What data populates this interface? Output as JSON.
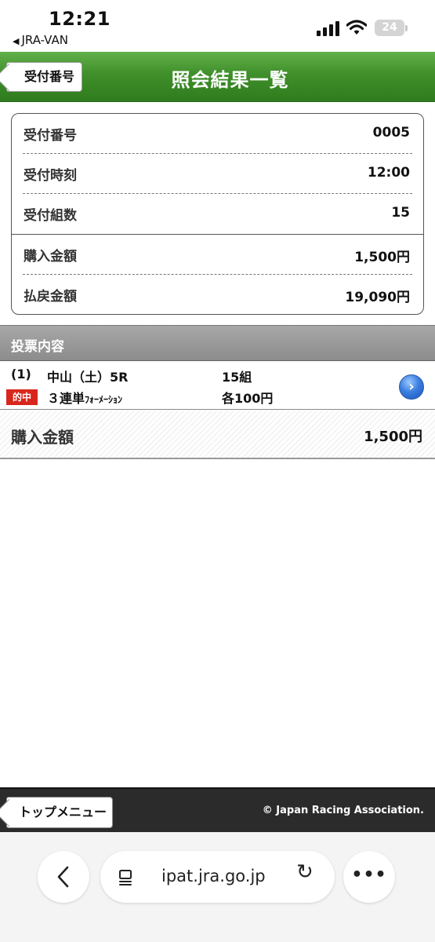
{
  "status_bar": {
    "time": "12:21",
    "back_app": "JRA-VAN",
    "battery": "24"
  },
  "header": {
    "back_label": "受付番号",
    "title": "照会結果一覧"
  },
  "summary": {
    "rows": [
      {
        "label": "受付番号",
        "value": "0005"
      },
      {
        "label": "受付時刻",
        "value": "12:00"
      },
      {
        "label": "受付組数",
        "value": "15"
      },
      {
        "label": "購入金額",
        "value": "1,500円"
      },
      {
        "label": "払戻金額",
        "value": "19,090円"
      }
    ]
  },
  "section": {
    "title": "投票内容"
  },
  "bet": {
    "number": "(1)",
    "race": "中山（土）5R",
    "badge": "的中",
    "type_prefix": "３連単",
    "type_suffix": "ﾌｫｰﾒｰｼｮﾝ",
    "combinations": "15組",
    "unit": "各100円"
  },
  "total": {
    "label": "購入金額",
    "value": "1,500円"
  },
  "footer": {
    "top_menu_label": "トップメニュー",
    "copyright": "© Japan Racing Association."
  },
  "browser": {
    "url": "ipat.jra.go.jp",
    "more": "•••"
  },
  "colors": {
    "header_green": "#3f8f2a",
    "badge_red": "#d9261c",
    "section_gray": "#9a9a9a",
    "footer_dark": "#2b2b2b",
    "arrow_blue": "#3a7fe0"
  }
}
